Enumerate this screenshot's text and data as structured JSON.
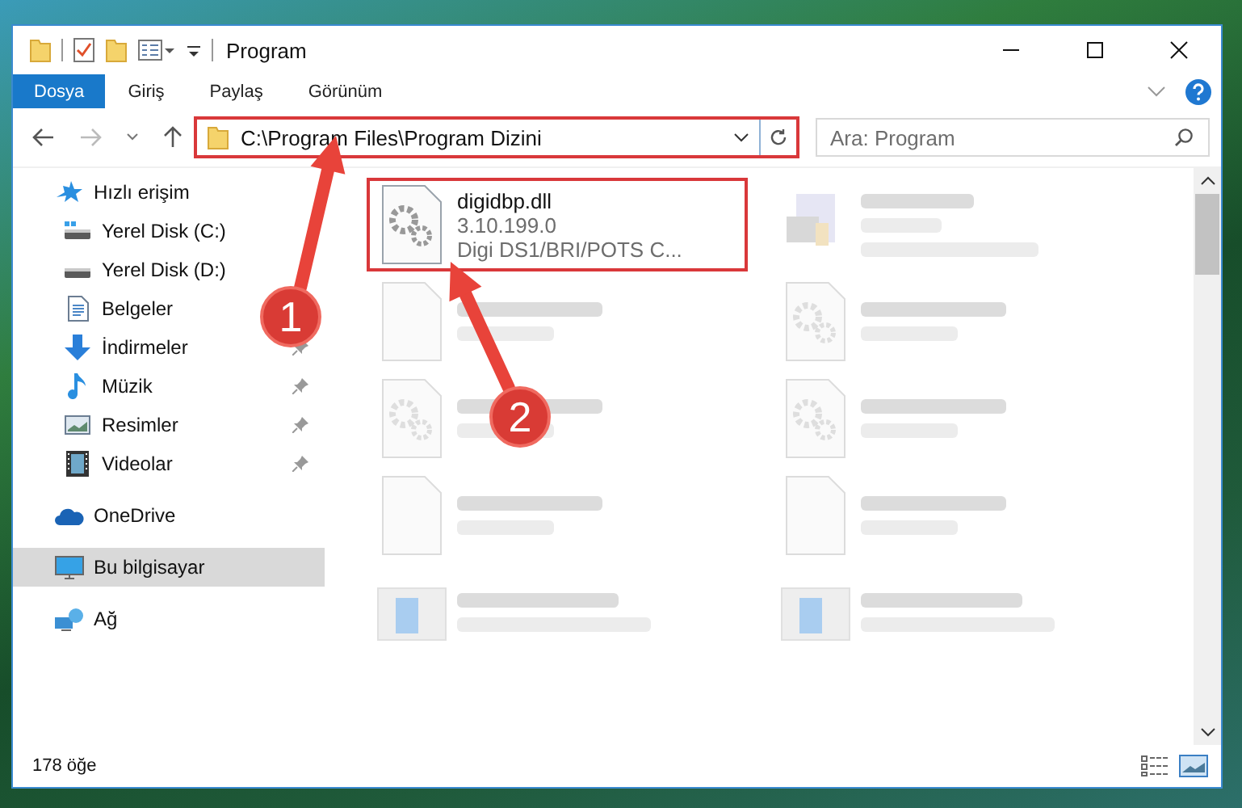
{
  "window": {
    "title": "Program"
  },
  "ribbon": {
    "tabs": [
      {
        "label": "Dosya",
        "kind": "file"
      },
      {
        "label": "Giriş",
        "kind": "tab"
      },
      {
        "label": "Paylaş",
        "kind": "tab"
      },
      {
        "label": "Görünüm",
        "kind": "tab"
      }
    ]
  },
  "address_bar": {
    "path": "C:\\Program Files\\Program Dizini",
    "highlighted": true
  },
  "search": {
    "placeholder": "Ara: Program"
  },
  "sidebar": {
    "items": [
      {
        "label": "Hızlı erişim",
        "kind": "quick",
        "selected": false,
        "children": [
          {
            "label": "Yerel Disk (C:)",
            "kind": "drive-c",
            "pinned": false,
            "selected": false
          },
          {
            "label": "Yerel Disk (D:)",
            "kind": "drive",
            "pinned": false,
            "selected": false
          },
          {
            "label": "Belgeler",
            "kind": "documents",
            "pinned": false,
            "selected": false
          },
          {
            "label": "İndirmeler",
            "kind": "downloads",
            "pinned": true,
            "selected": false
          },
          {
            "label": "Müzik",
            "kind": "music",
            "pinned": true,
            "selected": false
          },
          {
            "label": "Resimler",
            "kind": "pictures",
            "pinned": true,
            "selected": false
          },
          {
            "label": "Videolar",
            "kind": "videos",
            "pinned": true,
            "selected": false
          }
        ]
      },
      {
        "label": "OneDrive",
        "kind": "cloud",
        "selected": false
      },
      {
        "label": "Bu bilgisayar",
        "kind": "computer",
        "selected": true
      },
      {
        "label": "Ağ",
        "kind": "network",
        "selected": false
      }
    ]
  },
  "files": [
    {
      "name": "digidbp.dll",
      "details": [
        "3.10.199.0",
        "Digi DS1/BRI/POTS C..."
      ],
      "kind": "dll",
      "highlighted": true,
      "dimmed": false
    },
    {
      "kind": "exe",
      "highlighted": false,
      "dimmed": true
    },
    {
      "kind": "file",
      "highlighted": false,
      "dimmed": true
    },
    {
      "kind": "dll",
      "highlighted": false,
      "dimmed": true
    },
    {
      "kind": "dll",
      "highlighted": false,
      "dimmed": true
    },
    {
      "kind": "dll",
      "highlighted": false,
      "dimmed": true
    },
    {
      "kind": "file",
      "highlighted": false,
      "dimmed": true
    },
    {
      "kind": "file",
      "highlighted": false,
      "dimmed": true
    },
    {
      "kind": "installer",
      "highlighted": false,
      "dimmed": true
    },
    {
      "kind": "installer",
      "highlighted": false,
      "dimmed": true
    }
  ],
  "status_bar": {
    "count": "178 öğe"
  },
  "annotations": [
    {
      "label": "1"
    },
    {
      "label": "2"
    }
  ]
}
